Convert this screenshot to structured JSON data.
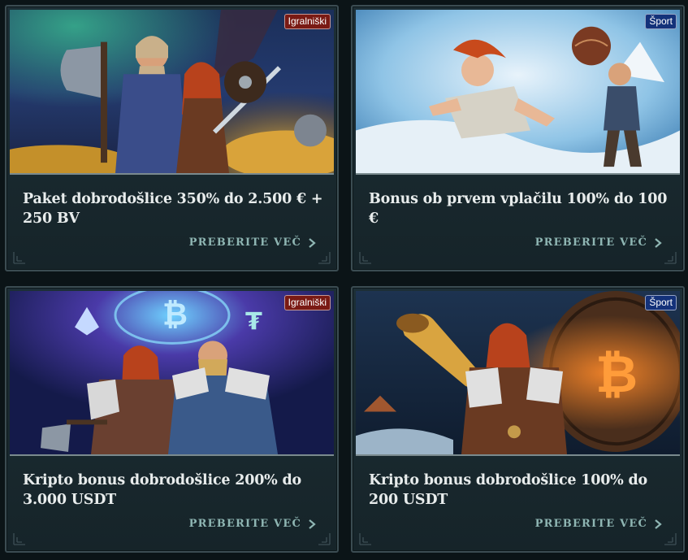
{
  "cards": [
    {
      "badge": "Igralniški",
      "badge_type": "casino",
      "title": "Paket dobrodošlice 350% do 2.500 € + 250 BV",
      "cta": "PREBERITE VEČ",
      "art": "viking-warriors-with-gold"
    },
    {
      "badge": "Šport",
      "badge_type": "sport",
      "title": "Bonus ob prvem vplačilu 100% do 100 €",
      "cta": "PREBERITE VEČ",
      "art": "viking-sports-snow"
    },
    {
      "badge": "Igralniški",
      "badge_type": "casino",
      "title": "Kripto bonus dobrodošlice 200% do 3.000 USDT",
      "cta": "PREBERITE VEČ",
      "art": "vikings-crypto-portal"
    },
    {
      "badge": "Šport",
      "badge_type": "sport",
      "title": "Kripto bonus dobrodošlice 100% do 200 USDT",
      "cta": "PREBERITE VEČ",
      "art": "viking-horn-bitcoin-shield"
    }
  ],
  "colors": {
    "background": "#0b1417",
    "card": "#1d2f36",
    "cta": "#8fb6b3",
    "casino_badge": "#7a1a14",
    "sport_badge": "#14327a"
  },
  "icons": {
    "cta_arrow": "chevron-right-icon",
    "corner": "corner-ornament-icon"
  }
}
